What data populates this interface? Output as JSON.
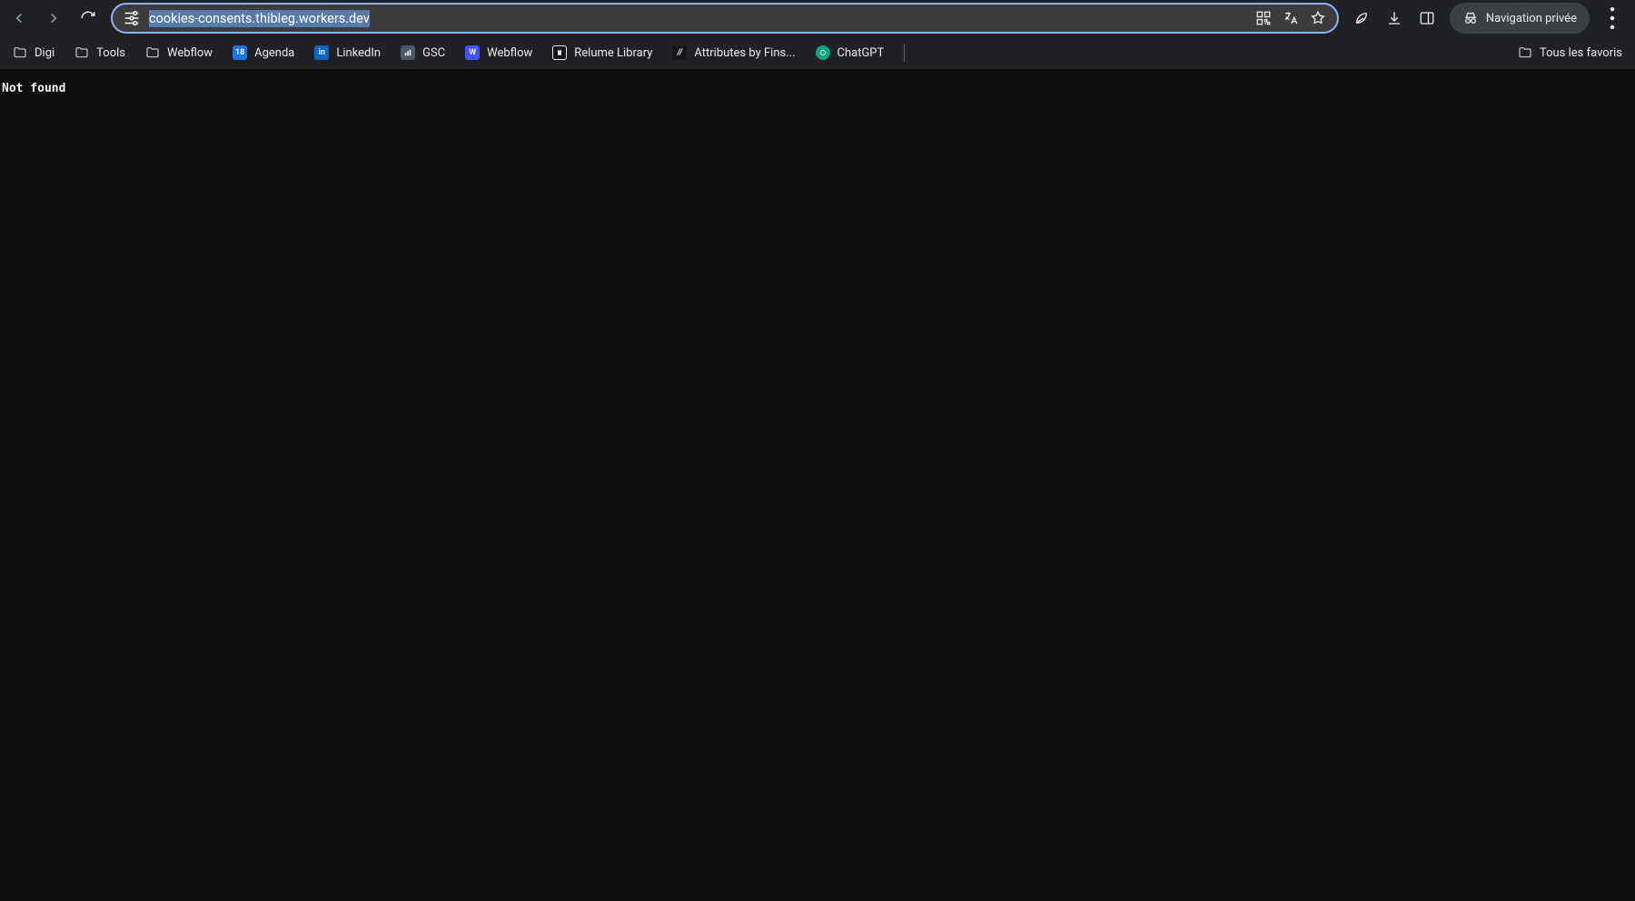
{
  "toolbar": {
    "url": "cookies-consents.thibleg.workers.dev",
    "incognito_label": "Navigation privée"
  },
  "bookmarks": {
    "items": [
      {
        "type": "folder",
        "label": "Digi"
      },
      {
        "type": "folder",
        "label": "Tools"
      },
      {
        "type": "folder",
        "label": "Webflow"
      },
      {
        "type": "site",
        "label": "Agenda",
        "icon": "calendar",
        "bg": "#1a73e8"
      },
      {
        "type": "site",
        "label": "LinkedIn",
        "icon": "in",
        "bg": "#0a66c2"
      },
      {
        "type": "site",
        "label": "GSC",
        "icon": "gsc",
        "bg": "#4d5862"
      },
      {
        "type": "site",
        "label": "Webflow",
        "icon": "wf",
        "bg": "#4353ff"
      },
      {
        "type": "site",
        "label": "Relume Library",
        "icon": "rl",
        "bg": "#151515"
      },
      {
        "type": "site",
        "label": "Attributes by Fins...",
        "icon": "fs",
        "bg": "#151515"
      },
      {
        "type": "site",
        "label": "ChatGPT",
        "icon": "gpt",
        "bg": "#10a37f"
      }
    ],
    "all_favorites_label": "Tous les favoris"
  },
  "page": {
    "body_text": "Not found"
  }
}
